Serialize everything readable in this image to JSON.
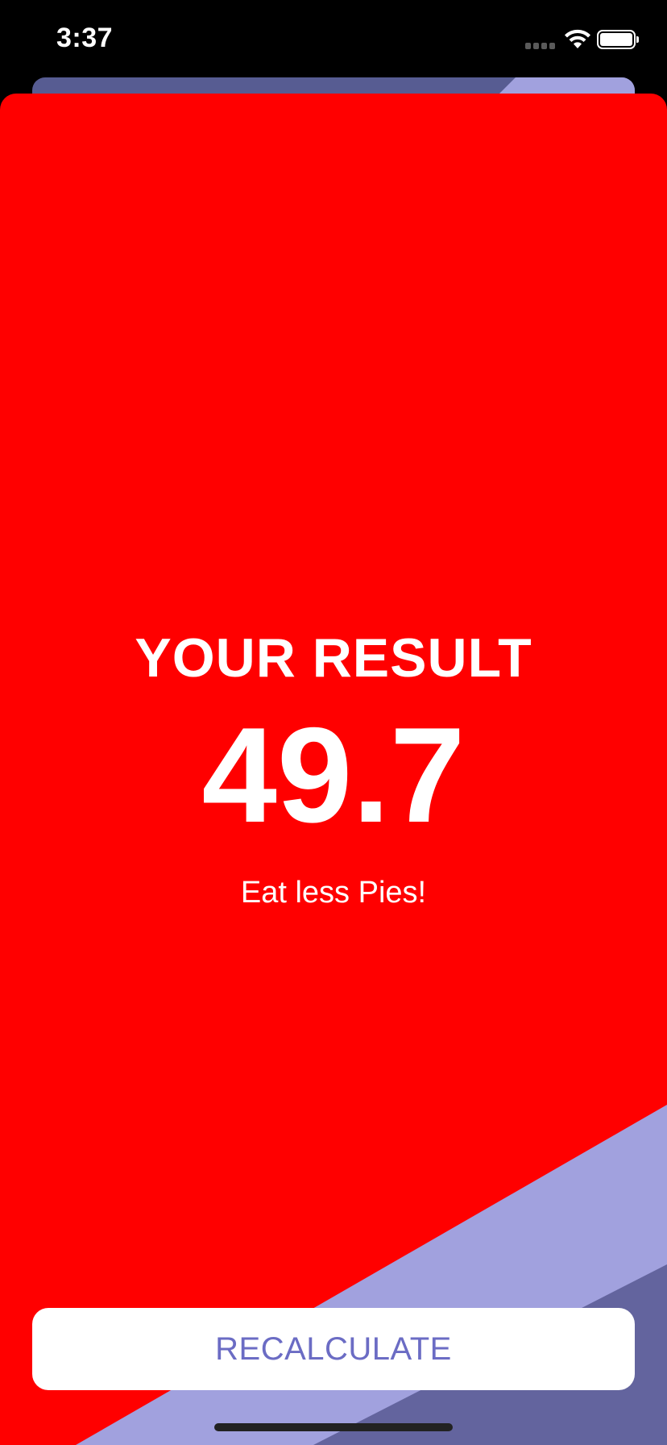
{
  "status_bar": {
    "time": "3:37"
  },
  "icons": {
    "signal": "cellular-signal-icon",
    "wifi": "wifi-icon",
    "battery": "battery-icon"
  },
  "result": {
    "title": "YOUR RESULT",
    "value": "49.7",
    "advice": "Eat less Pies!"
  },
  "actions": {
    "recalculate_label": "RECALCULATE"
  },
  "colors": {
    "sheet_background": "#ff0000",
    "stripe_light": "#a1a1de",
    "stripe_dark": "#63649e",
    "back_card": "#575c92",
    "button_text": "#6b6cc4",
    "text": "#ffffff"
  }
}
